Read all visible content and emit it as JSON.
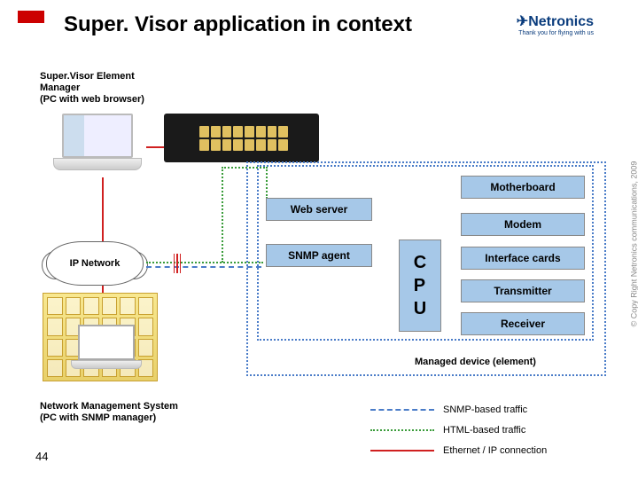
{
  "header": {
    "title": "Super. Visor application in context",
    "logo_name": "Netronics",
    "logo_tagline": "Thank you for flying with us"
  },
  "captions": {
    "element_manager": "Super.Visor Element\nManager\n(PC with web browser)",
    "nms": "Network Management System\n(PC with SNMP manager)"
  },
  "nodes": {
    "ip_network": "IP Network",
    "web_server": "Web server",
    "snmp_agent": "SNMP agent",
    "cpu": "C\nP\nU",
    "motherboard": "Motherboard",
    "modem": "Modem",
    "interface_cards": "Interface cards",
    "transmitter": "Transmitter",
    "receiver": "Receiver",
    "managed_device": "Managed device (element)"
  },
  "legend": {
    "snmp": "SNMP-based traffic",
    "html": "HTML-based traffic",
    "eth": "Ethernet / IP connection"
  },
  "page_number": "44",
  "copyright": "© Copy Right Netronics communications, 2009"
}
